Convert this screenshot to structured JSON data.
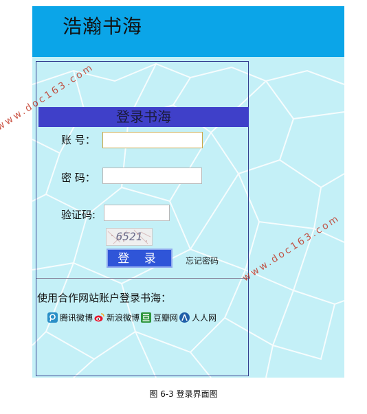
{
  "header": {
    "site_title": "浩瀚书海",
    "background": "#0ba5e8"
  },
  "login": {
    "title": "登录书海",
    "account_label": "账  号：",
    "account_value": "",
    "password_label": "密  码：",
    "password_value": "",
    "captcha_label": "验证码:",
    "captcha_value": "",
    "captcha_image_text": "6521",
    "login_button": "登 录",
    "forgot_link": "忘记密码"
  },
  "partners": {
    "title": "使用合作网站账户登录书海：",
    "items": [
      {
        "label": "腾讯微博",
        "icon": "tencent-weibo-icon"
      },
      {
        "label": "新浪微博",
        "icon": "sina-weibo-icon"
      },
      {
        "label": "豆瓣网",
        "icon": "douban-icon"
      },
      {
        "label": "人人网",
        "icon": "renren-icon"
      }
    ]
  },
  "caption": "图 6-3  登录界面图",
  "watermark": {
    "text": "www.doc163.com"
  },
  "colors": {
    "accent": "#3f40c9",
    "button": "#2f55d8",
    "panel_bg": "#c4f0f7"
  }
}
